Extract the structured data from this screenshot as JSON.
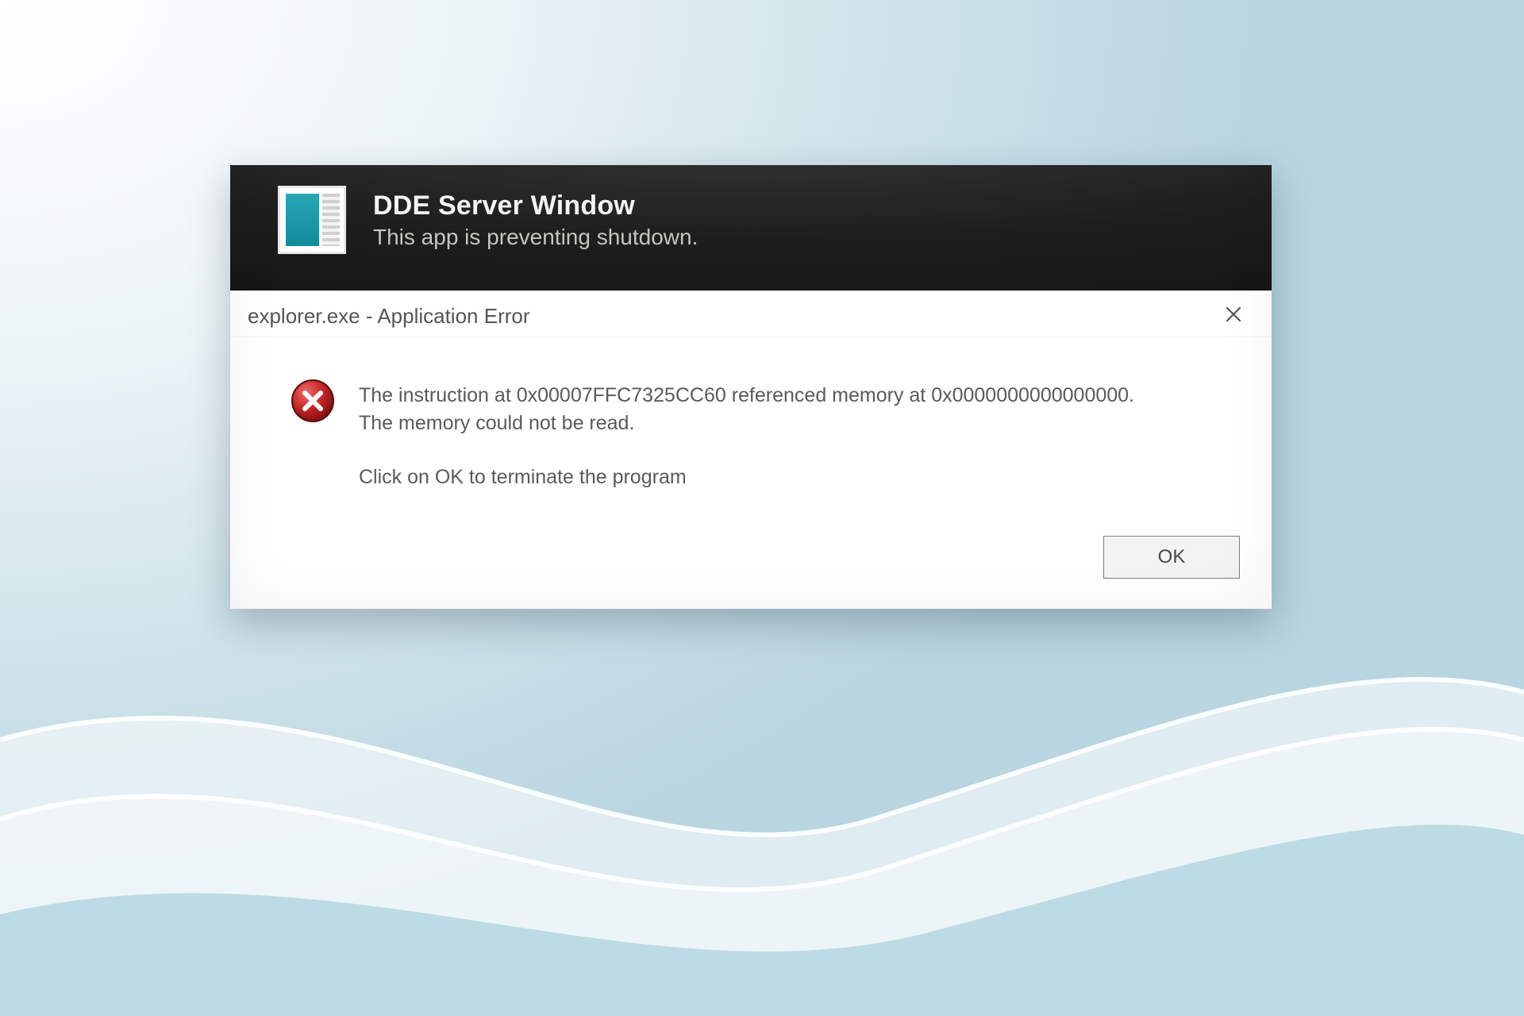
{
  "banner": {
    "title": "DDE Server Window",
    "subtitle": "This app is preventing shutdown."
  },
  "dialog": {
    "title": "explorer.exe - Application Error",
    "message_line1": "The instruction at 0x00007FFC7325CC60 referenced memory at 0x0000000000000000. The memory could not be read.",
    "message_line2": "Click on OK to terminate the program",
    "ok_label": "OK"
  }
}
